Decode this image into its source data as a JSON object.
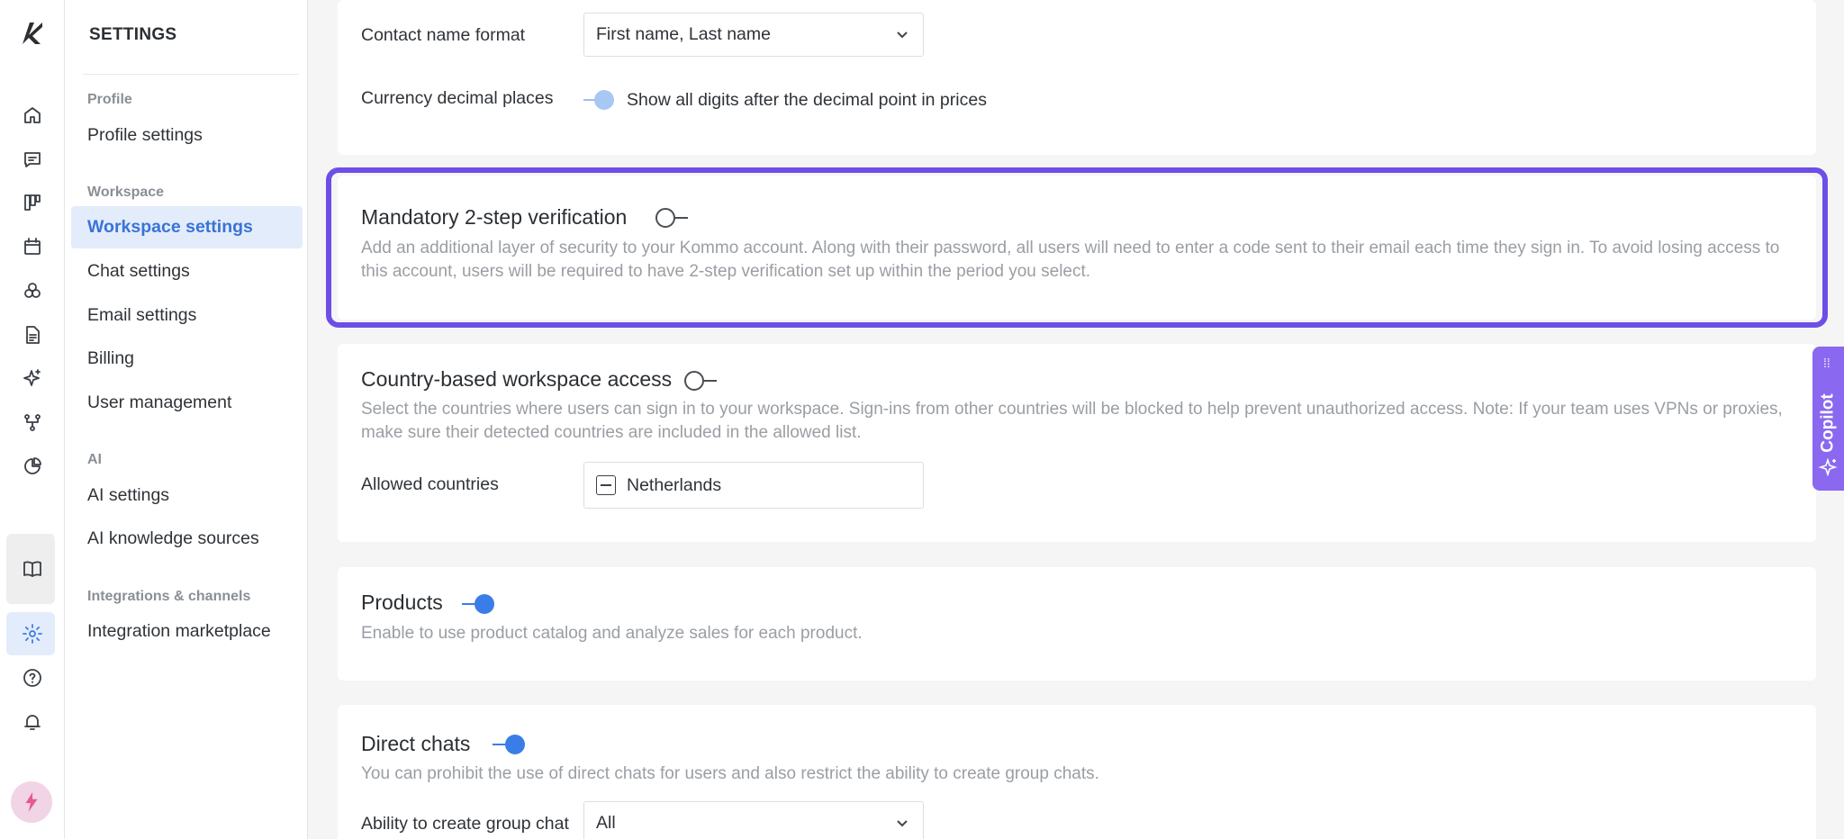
{
  "settings_nav": {
    "title": "SETTINGS",
    "sections": [
      {
        "label": "Profile"
      },
      {
        "label": "Workspace"
      },
      {
        "label": "AI"
      },
      {
        "label": "Integrations & channels"
      }
    ],
    "items": [
      {
        "label": "Profile settings"
      },
      {
        "label": "Workspace settings"
      },
      {
        "label": "Chat settings"
      },
      {
        "label": "Email settings"
      },
      {
        "label": "Billing"
      },
      {
        "label": "User management"
      },
      {
        "label": "AI settings"
      },
      {
        "label": "AI knowledge sources"
      },
      {
        "label": "Integration marketplace"
      }
    ],
    "active_item": "Workspace settings"
  },
  "rail_icons": [
    "kommo-logo-icon",
    "home-icon",
    "chat-icon",
    "pipeline-icon",
    "calendar-icon",
    "contacts-icon",
    "document-icon",
    "sparkle-icon",
    "flow-icon",
    "analytics-icon",
    "book-icon",
    "gear-icon",
    "help-icon",
    "bell-icon",
    "avatar"
  ],
  "general": {
    "contact_name_format_label": "Contact name format",
    "contact_name_format_value": "First name, Last name",
    "currency_decimal_label": "Currency decimal places",
    "currency_decimal_toggle_text": "Show all digits after the decimal point in prices",
    "currency_decimal_enabled": true
  },
  "two_step": {
    "title": "Mandatory 2-step verification",
    "enabled": false,
    "description": "Add an additional layer of security to your Kommo account. Along with their password, all users will need to enter a code sent to their email each time they sign in. To avoid losing access to this account, users will be required to have 2-step verification set up within the period you select."
  },
  "country_access": {
    "title": "Country-based workspace access",
    "enabled": false,
    "description": "Select the countries where users can sign in to your workspace. Sign-ins from other countries will be blocked to help prevent unauthorized access. Note: If your team uses VPNs or proxies, make sure their detected countries are included in the allowed list.",
    "allowed_label": "Allowed countries",
    "allowed_value": "Netherlands"
  },
  "products": {
    "title": "Products",
    "enabled": true,
    "description": "Enable to use product catalog and analyze sales for each product."
  },
  "direct_chats": {
    "title": "Direct chats",
    "enabled": true,
    "description": "You can prohibit the use of direct chats for users and also restrict the ability to create group chats.",
    "group_chat_label": "Ability to create group chat",
    "group_chat_value": "All"
  },
  "copilot": {
    "label": "Copilot"
  },
  "colors": {
    "accent": "#3b7de6",
    "highlight": "#6d4ee6",
    "copilot": "#8a68f0"
  }
}
